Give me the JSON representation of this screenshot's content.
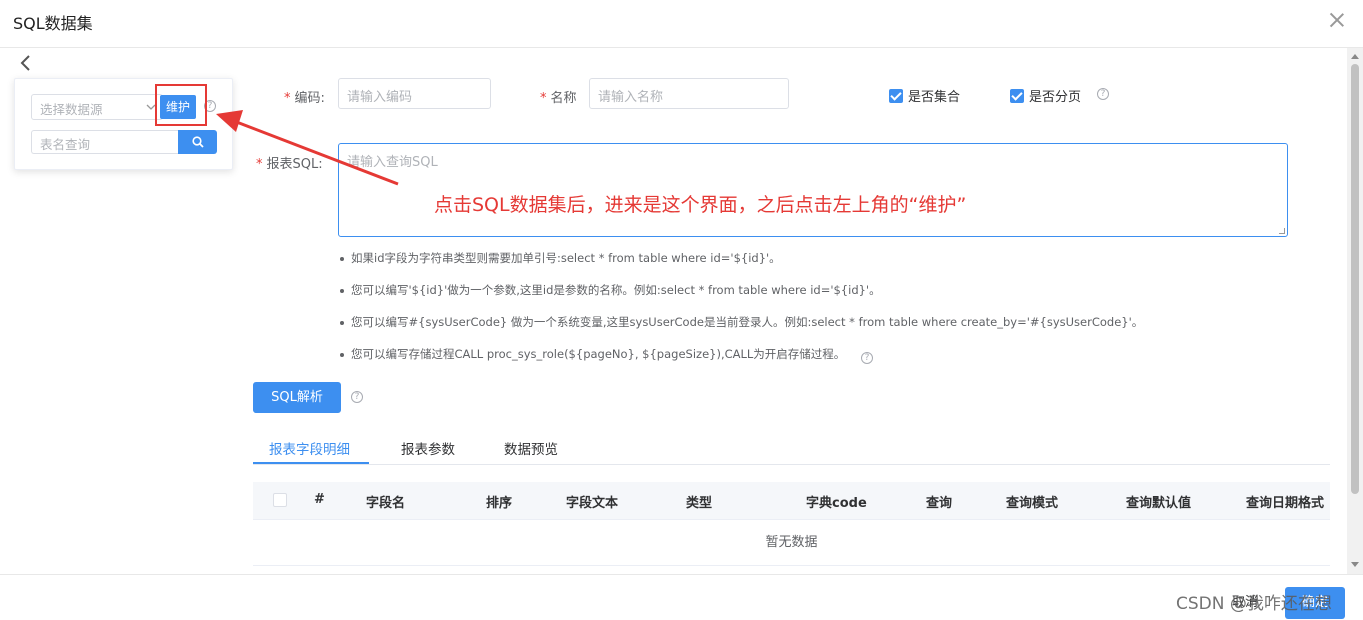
{
  "dialog": {
    "title": "SQL数据集"
  },
  "datasource_panel": {
    "select_placeholder": "选择数据源",
    "maintain_label": "维护",
    "table_search_placeholder": "表名查询"
  },
  "form": {
    "code_label": "编码:",
    "code_placeholder": "请输入编码",
    "name_label": "名称",
    "name_placeholder": "请输入名称",
    "is_collection_label": "是否集合",
    "is_paging_label": "是否分页",
    "sql_label": "报表SQL:",
    "sql_placeholder": "请输入查询SQL"
  },
  "annotation": "点击SQL数据集后，进来是这个界面，之后点击左上角的“维护”",
  "tips": [
    "如果id字段为字符串类型则需要加单引号:select * from table where id='${id}'。",
    "您可以编写'${id}'做为一个参数,这里id是参数的名称。例如:select * from table where id='${id}'。",
    "您可以编写#{sysUserCode} 做为一个系统变量,这里sysUserCode是当前登录人。例如:select * from table where create_by='#{sysUserCode}'。",
    "您可以编写存储过程CALL proc_sys_role(${pageNo}, ${pageSize}),CALL为开启存储过程。"
  ],
  "sql_parse_label": "SQL解析",
  "tabs": [
    "报表字段明细",
    "报表参数",
    "数据预览"
  ],
  "grid": {
    "columns": [
      "#",
      "字段名",
      "排序",
      "字段文本",
      "类型",
      "字典code",
      "查询",
      "查询模式",
      "查询默认值",
      "查询日期格式"
    ],
    "empty_text": "暂无数据"
  },
  "footer": {
    "cancel_label": "取消",
    "confirm_label": "确定",
    "watermark": "CSDN @我咋还在想"
  },
  "colors": {
    "primary": "#3d8ff0",
    "annotation": "#e53935"
  }
}
